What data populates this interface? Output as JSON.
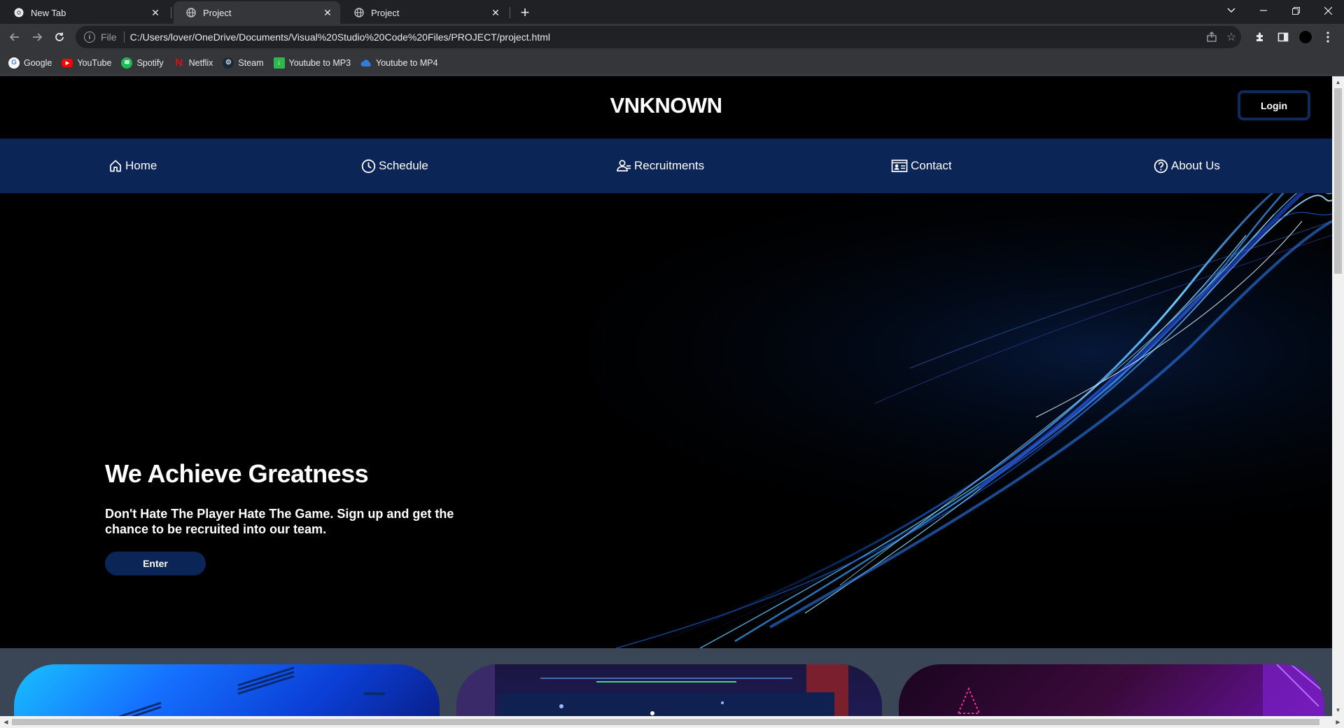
{
  "browser": {
    "tabs": [
      {
        "title": "New Tab",
        "icon": "chrome-icon"
      },
      {
        "title": "Project",
        "icon": "globe-icon"
      },
      {
        "title": "Project",
        "icon": "globe-icon"
      }
    ],
    "address": {
      "scheme": "File",
      "url": "C:/Users/lover/OneDrive/Documents/Visual%20Studio%20Code%20Files/PROJECT/project.html"
    },
    "bookmarks": [
      {
        "label": "Google",
        "icon": "google-icon",
        "color": "#ffffff"
      },
      {
        "label": "YouTube",
        "icon": "youtube-icon",
        "color": "#ff0000"
      },
      {
        "label": "Spotify",
        "icon": "spotify-icon",
        "color": "#1db954"
      },
      {
        "label": "Netflix",
        "icon": "netflix-icon",
        "color": "#e50914"
      },
      {
        "label": "Steam",
        "icon": "steam-icon",
        "color": "#1b2838"
      },
      {
        "label": "Youtube to MP3",
        "icon": "download-icon",
        "color": "#2db84b"
      },
      {
        "label": "Youtube to MP4",
        "icon": "cloud-icon",
        "color": "#2f7de1"
      }
    ]
  },
  "site": {
    "logo": "VNKNOWN",
    "login_label": "Login",
    "nav": [
      {
        "label": "Home",
        "icon": "home-icon"
      },
      {
        "label": "Schedule",
        "icon": "clock-icon"
      },
      {
        "label": "Recruitments",
        "icon": "users-icon"
      },
      {
        "label": "Contact",
        "icon": "contact-card-icon"
      },
      {
        "label": "About Us",
        "icon": "question-circle-icon"
      }
    ],
    "hero": {
      "title": "We Achieve Greatness",
      "subtitle": "Don't Hate The Player Hate The Game. Sign up and get the chance to be recruited into our team.",
      "button_label": "Enter"
    },
    "colors": {
      "nav_bg": "#0c2557",
      "accent": "#0f2b5b",
      "page_bg": "#000000"
    }
  }
}
